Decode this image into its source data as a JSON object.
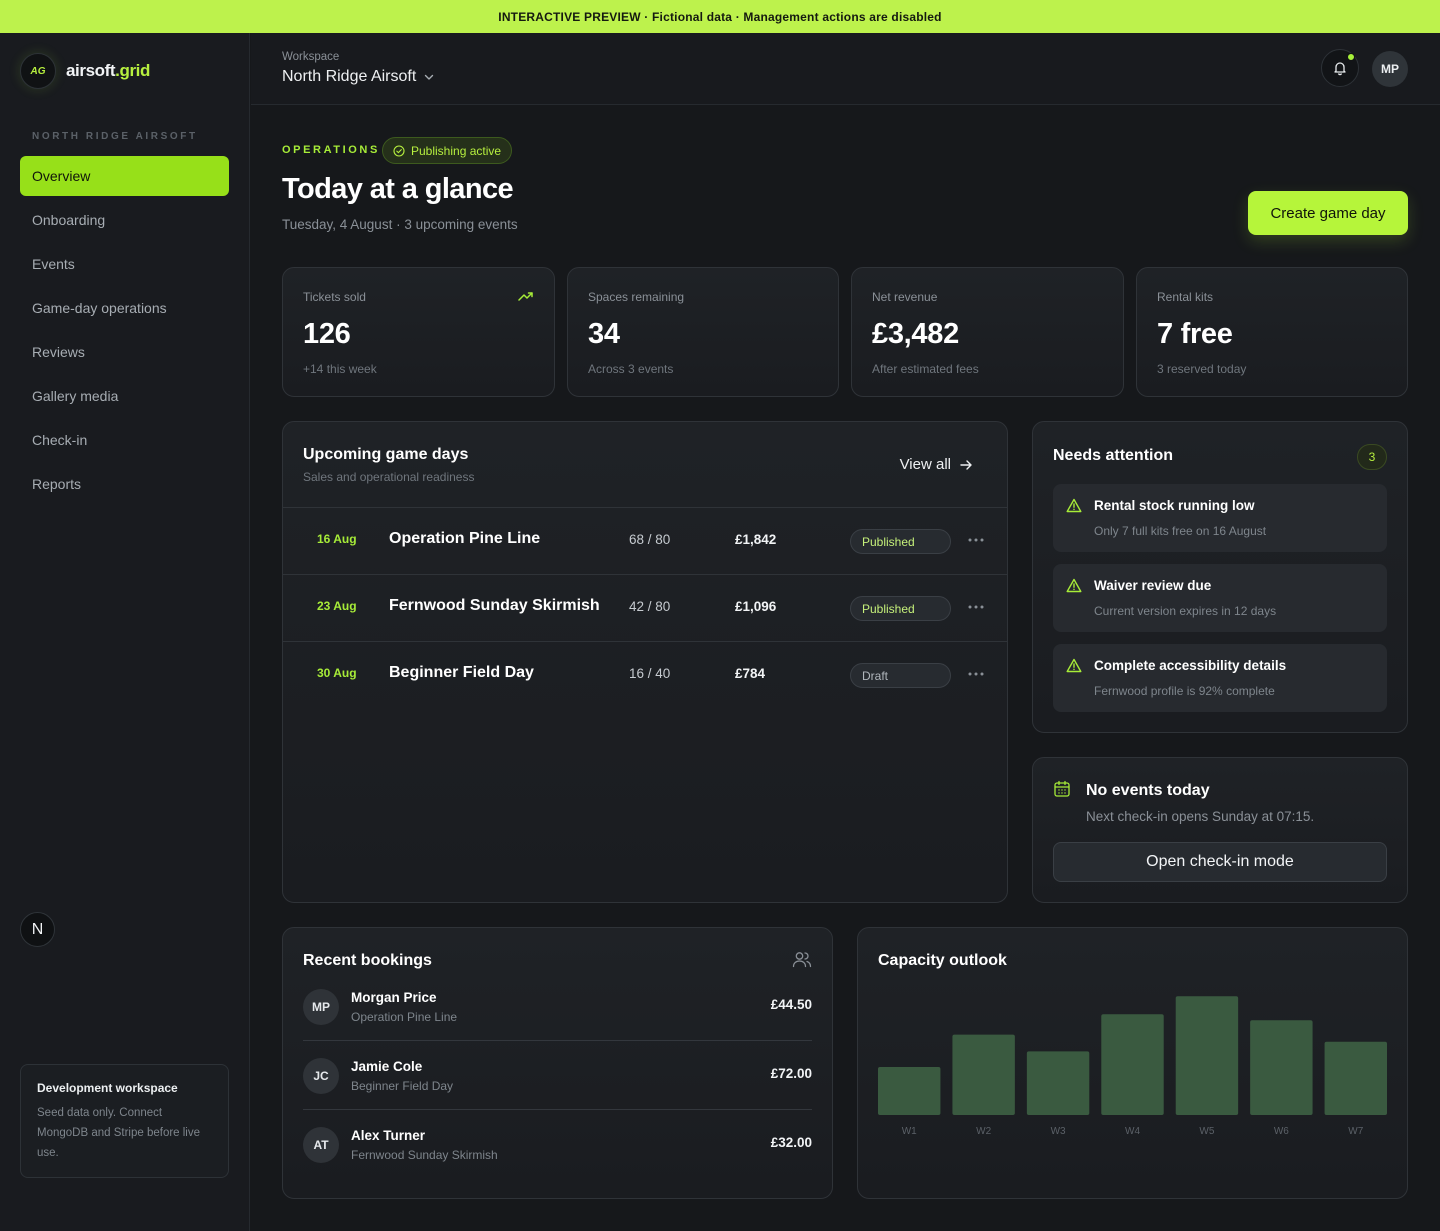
{
  "banner": "INTERACTIVE PREVIEW · Fictional data · Management actions are disabled",
  "brand": {
    "badge": "AG",
    "name_main": "airsoft",
    "name_accent": ".grid"
  },
  "sidebar": {
    "org_label": "NORTH RIDGE AIRSOFT",
    "items": [
      {
        "label": "Overview",
        "active": true
      },
      {
        "label": "Onboarding"
      },
      {
        "label": "Events"
      },
      {
        "label": "Game-day operations"
      },
      {
        "label": "Reviews"
      },
      {
        "label": "Gallery media"
      },
      {
        "label": "Check-in"
      },
      {
        "label": "Reports"
      }
    ],
    "n_badge": "N",
    "dev": {
      "title": "Development workspace",
      "text": "Seed data only. Connect MongoDB and Stripe before live use."
    }
  },
  "header": {
    "workspace_label": "Workspace",
    "workspace_name": "North Ridge Airsoft",
    "user_initials": "MP"
  },
  "page": {
    "eyebrow": "OPERATIONS",
    "status_pill": "Publishing active",
    "title": "Today at a glance",
    "subtitle": "Tuesday, 4 August · 3 upcoming events",
    "create_button": "Create game day"
  },
  "stats": [
    {
      "label": "Tickets sold",
      "value": "126",
      "note": "+14 this week"
    },
    {
      "label": "Spaces remaining",
      "value": "34",
      "note": "Across 3 events"
    },
    {
      "label": "Net revenue",
      "value": "£3,482",
      "note": "After estimated fees"
    },
    {
      "label": "Rental kits",
      "value": "7 free",
      "note": "3 reserved today"
    }
  ],
  "upcoming": {
    "title": "Upcoming game days",
    "subtitle": "Sales and operational readiness",
    "view_all": "View all",
    "events": [
      {
        "date": "16 Aug",
        "name": "Operation Pine Line",
        "capacity": "68 / 80",
        "revenue": "£1,842",
        "status": "Published"
      },
      {
        "date": "23 Aug",
        "name": "Fernwood Sunday Skirmish",
        "capacity": "42 / 80",
        "revenue": "£1,096",
        "status": "Published"
      },
      {
        "date": "30 Aug",
        "name": "Beginner Field Day",
        "capacity": "16 / 40",
        "revenue": "£784",
        "status": "Draft"
      }
    ]
  },
  "attention": {
    "title": "Needs attention",
    "count": "3",
    "items": [
      {
        "title": "Rental stock running low",
        "desc": "Only 7 full kits free on 16 August"
      },
      {
        "title": "Waiver review due",
        "desc": "Current version expires in 12 days"
      },
      {
        "title": "Complete accessibility details",
        "desc": "Fernwood profile is 92% complete"
      }
    ]
  },
  "no_events": {
    "title": "No events today",
    "text": "Next check-in opens Sunday at 07:15.",
    "button": "Open check-in mode"
  },
  "bookings": {
    "title": "Recent bookings",
    "items": [
      {
        "initials": "MP",
        "name": "Morgan Price",
        "event": "Operation Pine Line",
        "amount": "£44.50"
      },
      {
        "initials": "JC",
        "name": "Jamie Cole",
        "event": "Beginner Field Day",
        "amount": "£72.00"
      },
      {
        "initials": "AT",
        "name": "Alex Turner",
        "event": "Fernwood Sunday Skirmish",
        "amount": "£32.00"
      }
    ]
  },
  "capacity": {
    "title": "Capacity outlook"
  },
  "chart_data": {
    "type": "bar",
    "title": "Capacity outlook",
    "categories": [
      "W1",
      "W2",
      "W3",
      "W4",
      "W5",
      "W6",
      "W7"
    ],
    "values": [
      40,
      67,
      53,
      84,
      99,
      79,
      61
    ],
    "ylim": [
      0,
      100
    ],
    "grid": false,
    "bar_color": "#3a5a40"
  },
  "colors": {
    "accent": "#b7f03f",
    "banner": "#bdf24c",
    "background": "#16181b"
  }
}
